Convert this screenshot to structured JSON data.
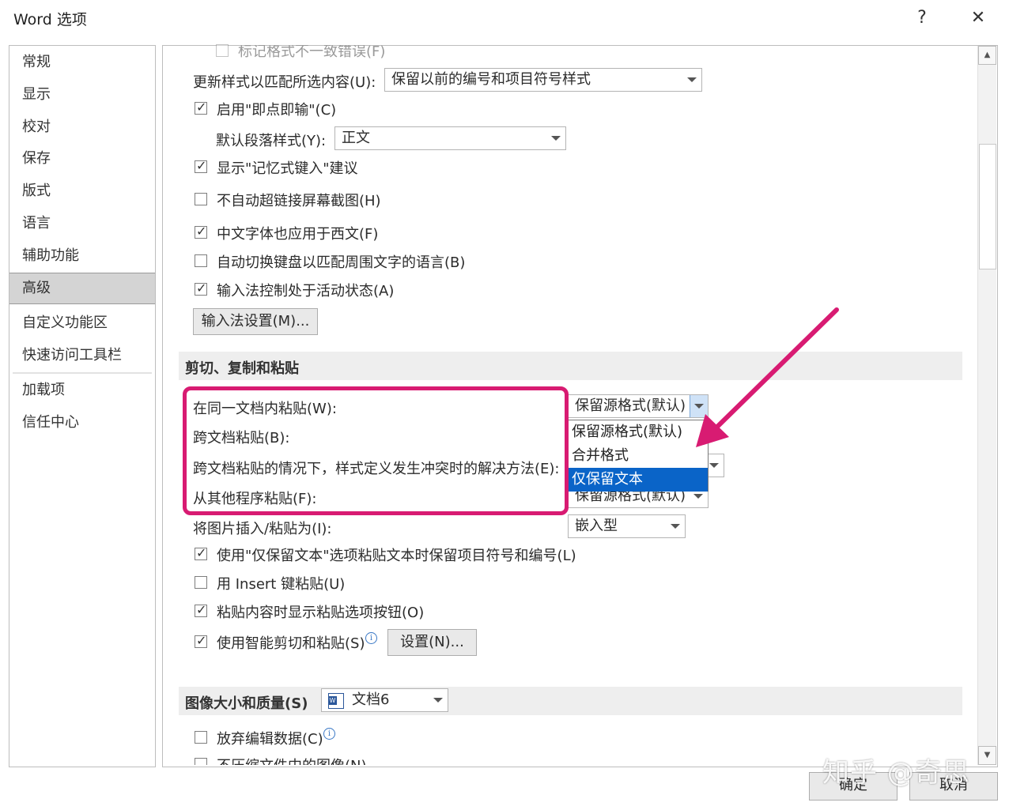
{
  "window": {
    "title": "Word 选项",
    "help": "?",
    "close": "✕"
  },
  "nav": {
    "items": [
      "常规",
      "显示",
      "校对",
      "保存",
      "版式",
      "语言",
      "辅助功能",
      "高级",
      "自定义功能区",
      "快速访问工具栏",
      "加载项",
      "信任中心"
    ],
    "selected": "高级"
  },
  "editing": {
    "clipped_top": "标记格式不一致错误(F)",
    "update_style_label": "更新样式以匹配所选内容(U):",
    "update_style_value": "保留以前的编号和项目符号样式",
    "click_and_type": "启用\"即点即输\"(C)",
    "default_para_label": "默认段落样式(Y):",
    "default_para_value": "正文",
    "show_autocomplete": "显示\"记忆式键入\"建议",
    "no_hyperlink_screenshot": "不自动超链接屏幕截图(H)",
    "cjk_font_latin": "中文字体也应用于西文(F)",
    "auto_keyboard": "自动切换键盘以匹配周围文字的语言(B)",
    "ime_active": "输入法控制处于活动状态(A)",
    "ime_settings_button": "输入法设置(M)..."
  },
  "cut_copy_paste": {
    "section_title": "剪切、复制和粘贴",
    "within_doc_label": "在同一文档内粘贴(W):",
    "within_doc_value": "保留源格式(默认)",
    "between_docs_label": "跨文档粘贴(B):",
    "style_conflict_label": "跨文档粘贴的情况下，样式定义发生冲突时的解决方法(E):",
    "other_programs_label": "从其他程序粘贴(F):",
    "other_programs_value": "保留源格式(默认)",
    "picture_label": "将图片插入/粘贴为(I):",
    "picture_value": "嵌入型",
    "dropdown_options": [
      "保留源格式(默认)",
      "合并格式",
      "仅保留文本"
    ],
    "dropdown_highlighted": "仅保留文本",
    "keep_bullets": "使用\"仅保留文本\"选项粘贴文本时保留项目符号和编号(L)",
    "insert_key": "用 Insert 键粘贴(U)",
    "show_paste_options": "粘贴内容时显示粘贴选项按钮(O)",
    "smart_cut_paste": "使用智能剪切和粘贴(S)",
    "settings_button": "设置(N)..."
  },
  "image_quality": {
    "section_title": "图像大小和质量(S)",
    "doc_value": "文档6",
    "discard_editing": "放弃编辑数据(C)",
    "clipped_bottom": "不压缩文件中的图像(N)"
  },
  "footer": {
    "ok": "确定",
    "cancel": "取消",
    "watermark": "知乎 @奇思"
  },
  "colors": {
    "highlight_box": "#d81b72",
    "arrow": "#d81b72",
    "selection": "#0a64c8"
  }
}
